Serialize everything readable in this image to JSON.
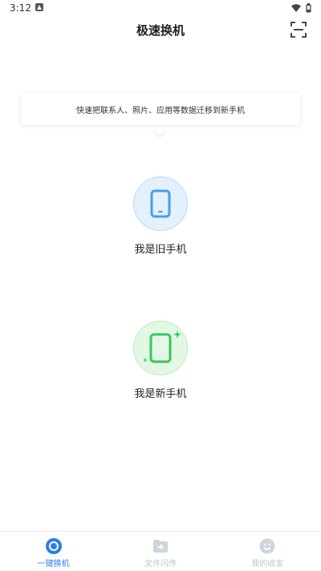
{
  "status_bar": {
    "time": "3:12"
  },
  "header": {
    "title": "极速换机",
    "scan_icon": "scan-icon"
  },
  "tip": {
    "text": "快速把联系人、照片、应用等数据迁移到新手机"
  },
  "roles": {
    "old_phone": {
      "label": "我是旧手机",
      "icon": "phone-icon",
      "color": "#4a9ee8"
    },
    "new_phone": {
      "label": "我是新手机",
      "icon": "phone-sparkle-icon",
      "color": "#39c55a"
    }
  },
  "bottom_nav": {
    "items": [
      {
        "label": "一键换机",
        "icon": "swap-icon",
        "active": true
      },
      {
        "label": "文件闪传",
        "icon": "folder-icon",
        "active": false
      },
      {
        "label": "我的收发",
        "icon": "smile-icon",
        "active": false
      }
    ]
  },
  "colors": {
    "accent": "#2b7de9",
    "inactive": "#c4c4c4"
  }
}
